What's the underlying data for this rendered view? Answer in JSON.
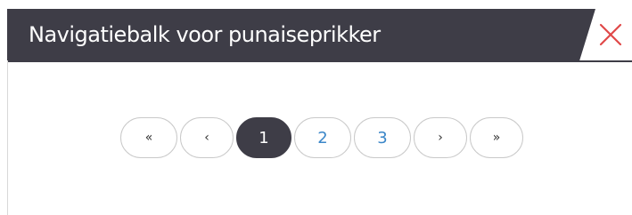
{
  "dialog": {
    "title": "Navigatiebalk voor punaiseprikker",
    "close_icon": "close-icon",
    "colors": {
      "header_bg": "#3e3d47",
      "close_icon": "#e04848",
      "link": "#3a86c8",
      "active_bg": "#3e3d47"
    }
  },
  "pagination": {
    "first_label": "«",
    "prev_label": "‹",
    "pages": [
      "1",
      "2",
      "3"
    ],
    "active_page": "1",
    "next_label": "›",
    "last_label": "»"
  }
}
